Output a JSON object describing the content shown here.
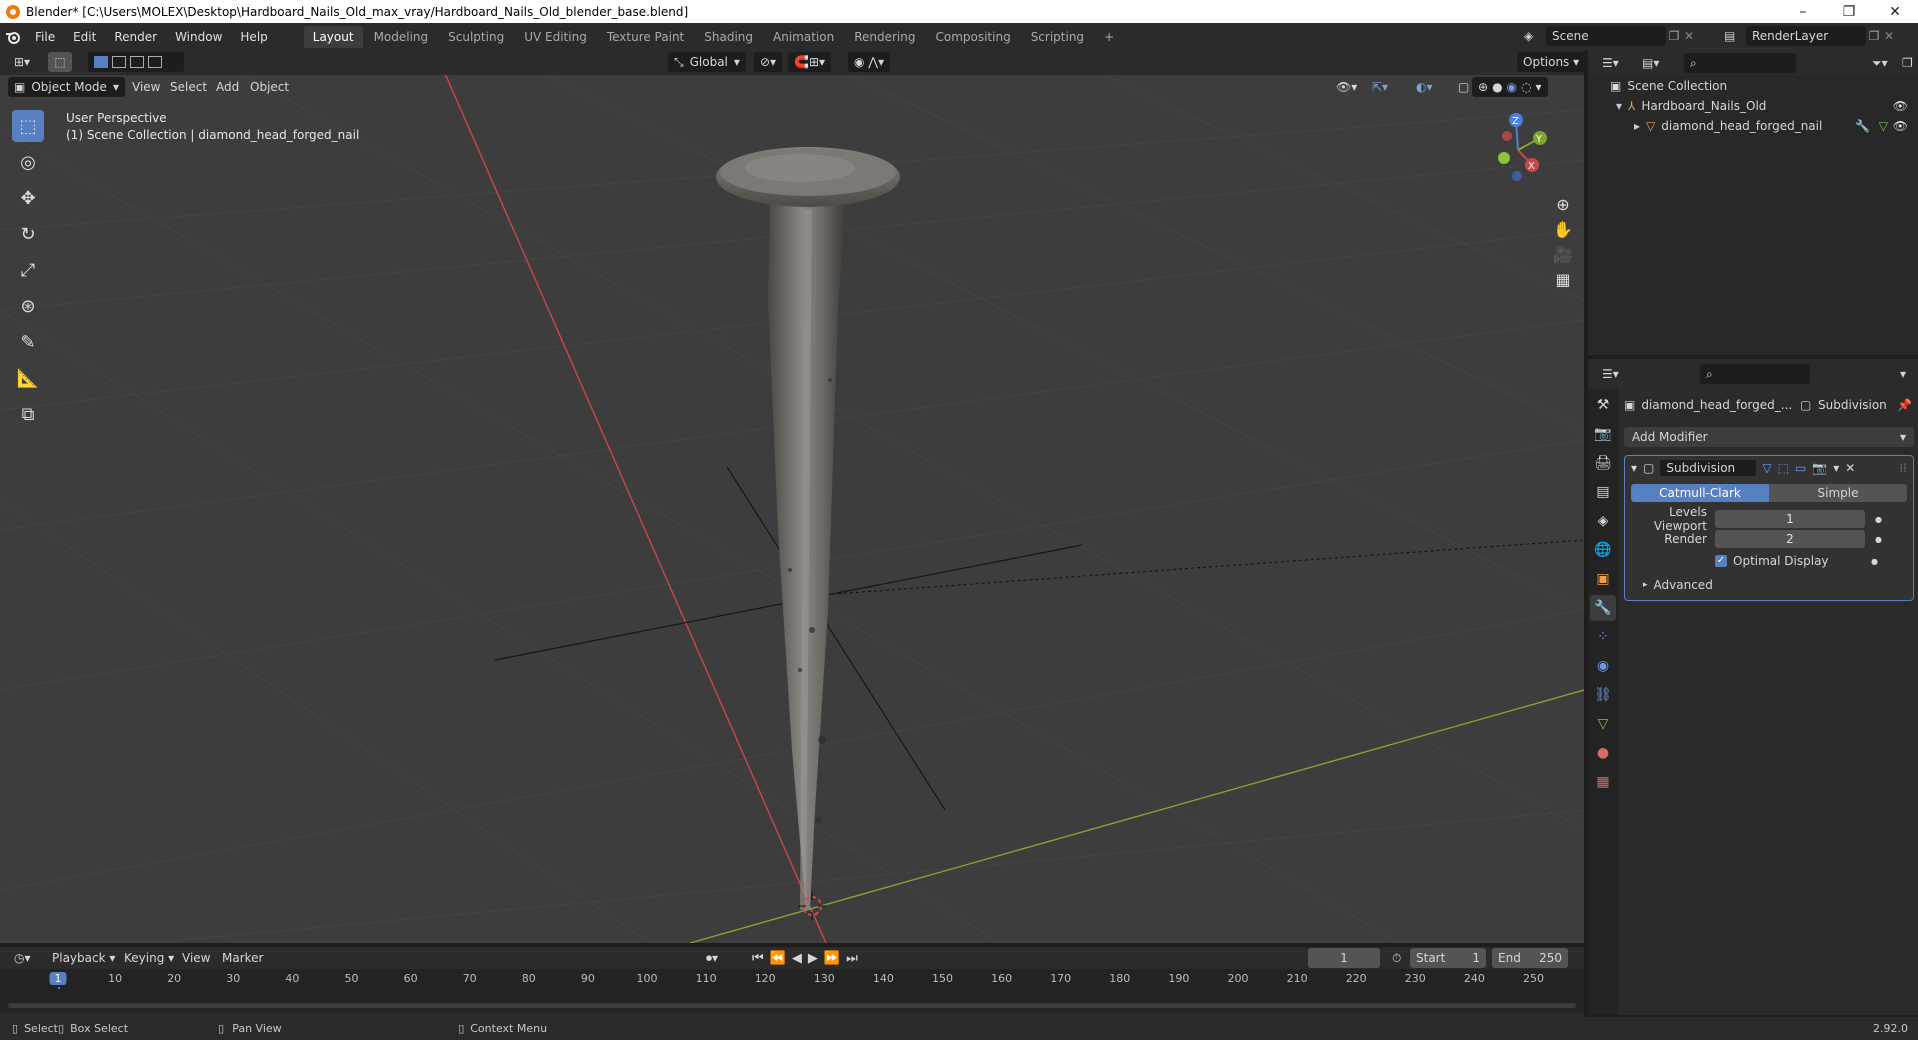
{
  "window": {
    "title": "Blender* [C:\\Users\\MOLEX\\Desktop\\Hardboard_Nails_Old_max_vray/Hardboard_Nails_Old_blender_base.blend]",
    "minimize": "–",
    "restore": "❐",
    "close": "✕"
  },
  "menu": [
    "File",
    "Edit",
    "Render",
    "Window",
    "Help"
  ],
  "workspaces": [
    "Layout",
    "Modeling",
    "Sculpting",
    "UV Editing",
    "Texture Paint",
    "Shading",
    "Animation",
    "Rendering",
    "Compositing",
    "Scripting"
  ],
  "active_workspace": "Layout",
  "scene": {
    "name": "Scene",
    "render_layer": "RenderLayer"
  },
  "viewport_header": {
    "transform_orientation": "Global",
    "options_label": "Options",
    "mode": "Object Mode",
    "menus": [
      "View",
      "Select",
      "Add",
      "Object"
    ]
  },
  "viewport": {
    "perspective_label": "User Perspective",
    "collection_label": "(1) Scene Collection | diamond_head_forged_nail",
    "gizmo": {
      "x": "X",
      "y": "Y",
      "z": "Z"
    }
  },
  "outliner": {
    "root": "Scene Collection",
    "collection": "Hardboard_Nails_Old",
    "object": "diamond_head_forged_nail"
  },
  "properties": {
    "object_name": "diamond_head_forged_...",
    "modifier_name_header": "Subdivision",
    "add_modifier": "Add Modifier",
    "modifier": {
      "name": "Subdivision",
      "algorithms": [
        "Catmull-Clark",
        "Simple"
      ],
      "active_algorithm": "Catmull-Clark",
      "levels_viewport_label": "Levels Viewport",
      "levels_viewport": "1",
      "render_label": "Render",
      "render": "2",
      "optimal_display_label": "Optimal Display",
      "optimal_display": true,
      "advanced_label": "Advanced"
    }
  },
  "timeline": {
    "menus": [
      "Playback",
      "Keying",
      "View",
      "Marker"
    ],
    "current_frame": "1",
    "start_label": "Start",
    "start": "1",
    "end_label": "End",
    "end": "250",
    "ruler": [
      "1",
      "10",
      "20",
      "30",
      "40",
      "50",
      "60",
      "70",
      "80",
      "90",
      "100",
      "110",
      "120",
      "130",
      "140",
      "150",
      "160",
      "170",
      "180",
      "190",
      "200",
      "210",
      "220",
      "230",
      "240",
      "250"
    ]
  },
  "statusbar": {
    "select": "Select",
    "box_select": "Box Select",
    "pan_view": "Pan View",
    "context_menu": "Context Menu",
    "version": "2.92.0"
  },
  "colors": {
    "accent": "#5680c2",
    "x_axis": "#c94848",
    "y_axis": "#7fa531",
    "viewport_bg": "#3d3d3d",
    "panel_bg": "#2b2b2b"
  }
}
